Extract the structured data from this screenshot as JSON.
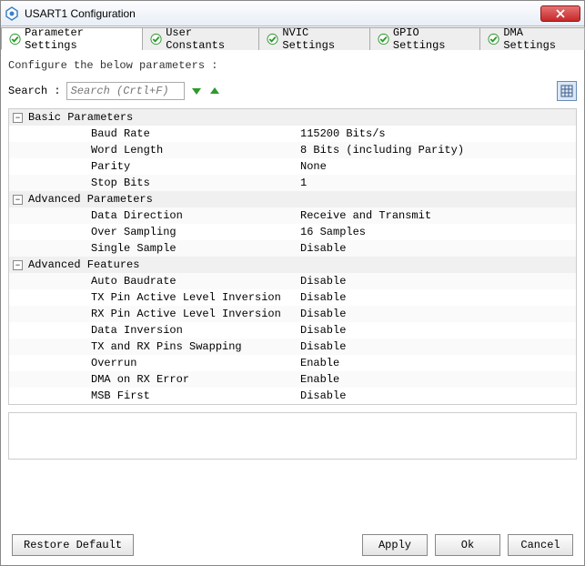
{
  "window": {
    "title": "USART1 Configuration"
  },
  "tabs": [
    {
      "label": "Parameter Settings",
      "active": true
    },
    {
      "label": "User Constants",
      "active": false
    },
    {
      "label": "NVIC Settings",
      "active": false
    },
    {
      "label": "GPIO Settings",
      "active": false
    },
    {
      "label": "DMA Settings",
      "active": false
    }
  ],
  "configure_label": "Configure the below parameters :",
  "search": {
    "label": "Search :",
    "placeholder": "Search (Crtl+F)"
  },
  "groups": [
    {
      "title": "Basic Parameters",
      "rows": [
        {
          "name": "Baud Rate",
          "value": "115200 Bits/s"
        },
        {
          "name": "Word Length",
          "value": "8 Bits (including Parity)"
        },
        {
          "name": "Parity",
          "value": "None"
        },
        {
          "name": "Stop Bits",
          "value": "1"
        }
      ]
    },
    {
      "title": "Advanced Parameters",
      "rows": [
        {
          "name": "Data Direction",
          "value": "Receive and Transmit"
        },
        {
          "name": "Over Sampling",
          "value": "16 Samples"
        },
        {
          "name": "Single Sample",
          "value": "Disable"
        }
      ]
    },
    {
      "title": "Advanced Features",
      "rows": [
        {
          "name": "Auto Baudrate",
          "value": "Disable"
        },
        {
          "name": "TX Pin Active Level Inversion",
          "value": "Disable"
        },
        {
          "name": "RX Pin Active Level Inversion",
          "value": "Disable"
        },
        {
          "name": "Data Inversion",
          "value": "Disable"
        },
        {
          "name": "TX and RX Pins Swapping",
          "value": "Disable"
        },
        {
          "name": "Overrun",
          "value": "Enable"
        },
        {
          "name": "DMA on RX Error",
          "value": "Enable"
        },
        {
          "name": "MSB First",
          "value": "Disable"
        }
      ]
    }
  ],
  "buttons": {
    "restore": "Restore Default",
    "apply": "Apply",
    "ok": "Ok",
    "cancel": "Cancel"
  }
}
